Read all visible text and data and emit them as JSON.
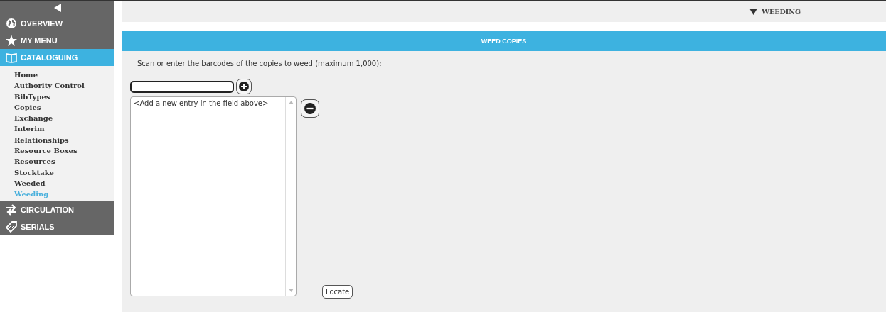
{
  "sidebar": {
    "sections": [
      {
        "label": "OVERVIEW",
        "selected": false
      },
      {
        "label": "MY MENU",
        "selected": false
      },
      {
        "label": "CATALOGUING",
        "selected": true,
        "items": [
          {
            "label": "Home",
            "selected": false
          },
          {
            "label": "Authority Control",
            "selected": false
          },
          {
            "label": "BibTypes",
            "selected": false
          },
          {
            "label": "Copies",
            "selected": false
          },
          {
            "label": "Exchange",
            "selected": false
          },
          {
            "label": "Interim",
            "selected": false
          },
          {
            "label": "Relationships",
            "selected": false
          },
          {
            "label": "Resource Boxes",
            "selected": false
          },
          {
            "label": "Resources",
            "selected": false
          },
          {
            "label": "Stocktake",
            "selected": false
          },
          {
            "label": "Weeded",
            "selected": false
          },
          {
            "label": "Weeding",
            "selected": true
          }
        ]
      },
      {
        "label": "CIRCULATION",
        "selected": false
      },
      {
        "label": "SERIALS",
        "selected": false
      }
    ]
  },
  "breadcrumb": "WEEDING",
  "panel": {
    "title": "WEED COPIES",
    "instruction": "Scan or enter the barcodes of the copies to weed (maximum 1,000):",
    "list": [
      "<Add a new entry in the field above>"
    ],
    "locate_button": "Locate"
  }
}
